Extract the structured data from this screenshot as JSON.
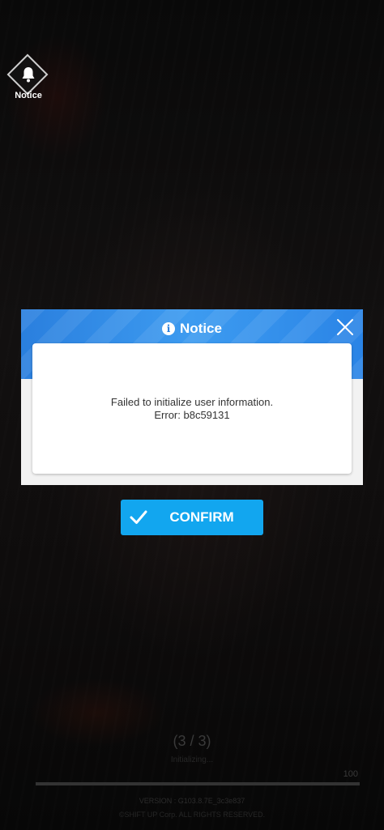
{
  "notice_button": {
    "label": "Notice",
    "icon": "bell-icon"
  },
  "dialog": {
    "title": "Notice",
    "title_icon": "info-icon",
    "close_icon": "close-icon",
    "message_line1": "Failed to initialize user information.",
    "message_line2": "Error: b8c59131"
  },
  "confirm_button": {
    "label": "CONFIRM",
    "icon": "check-icon"
  },
  "loading": {
    "count": "(3 / 3)",
    "status": "Initializing...",
    "percent": "100",
    "progress": 1.0,
    "version": "VERSION : G103.8.7E_3c3e837",
    "copyright": "©SHIFT UP Corp. ALL RIGHTS RESERVED."
  },
  "colors": {
    "header_blue": "#2a84e6",
    "confirm_blue": "#12a6ef",
    "background": "#0b0b0b"
  }
}
